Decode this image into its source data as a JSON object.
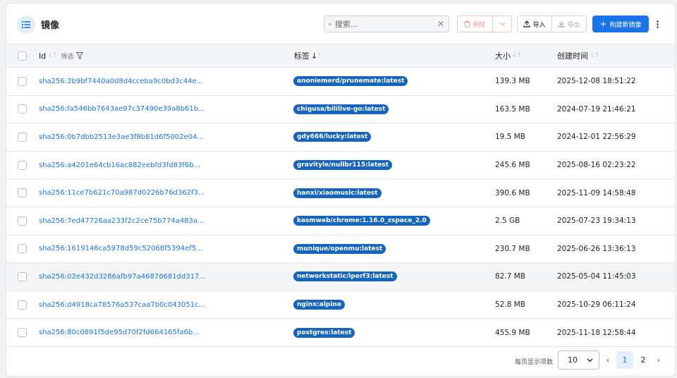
{
  "header": {
    "title": "镜像",
    "search_placeholder": "搜索...",
    "delete_label": "删除",
    "import_label": "导入",
    "export_label": "导出",
    "build_label": "构建新镜像"
  },
  "table": {
    "columns": {
      "id": "Id",
      "filter": "筛选",
      "tags": "标签",
      "size": "大小",
      "created": "创建时间"
    },
    "rows": [
      {
        "id": "sha256:2b9bf7440a0d8d4cceba9c0bd3c44e...",
        "tag": "anoniemerd/prunemate:latest",
        "size": "139.3 MB",
        "created": "2025-12-08 18:51:22"
      },
      {
        "id": "sha256:fa546bb7643ae97c37490e39a8b61b...",
        "tag": "chigusa/bililive-go:latest",
        "size": "163.5 MB",
        "created": "2024-07-19 21:46:21"
      },
      {
        "id": "sha256:0b7dbb2513e3ae3f8b81d6f5002e04...",
        "tag": "gdy666/lucky:latest",
        "size": "19.5 MB",
        "created": "2024-12-01 22:56:29"
      },
      {
        "id": "sha256:a4201e64cb16ac882eebfd3fd83f6b...",
        "tag": "gravityle/nullbr115:latest",
        "size": "245.6 MB",
        "created": "2025-08-16 02:23:22"
      },
      {
        "id": "sha256:11ce7b621c70a987d0226b76d362f3...",
        "tag": "hanxi/xiaomusic:latest",
        "size": "390.6 MB",
        "created": "2025-11-09 14:58:48"
      },
      {
        "id": "sha256:7ed47726aa233f2c2ce75b774a483a...",
        "tag": "kasmweb/chrome:1.16.0_zspace_2.0",
        "size": "2.5 GB",
        "created": "2025-07-23 19:34:13"
      },
      {
        "id": "sha256:1619146ca5978d59c52068f5394ef5...",
        "tag": "munique/openmu:latest",
        "size": "230.7 MB",
        "created": "2025-06-26 13:36:13"
      },
      {
        "id": "sha256:02e432d3286afb97a46876681dd317...",
        "tag": "networkstatic/iperf3:latest",
        "size": "82.7 MB",
        "created": "2025-05-04 11:45:03"
      },
      {
        "id": "sha256:d4918ca78576a537caa7b0c043051c...",
        "tag": "nginx:alpine",
        "size": "52.8 MB",
        "created": "2025-10-29 06:11:24"
      },
      {
        "id": "sha256:80c0891f5de95d70f2fd664165fa6b...",
        "tag": "postgres:latest",
        "size": "455.9 MB",
        "created": "2025-11-18 12:58:44"
      }
    ]
  },
  "pagination": {
    "per_page_label": "每页显示项数",
    "per_page_value": "10",
    "prev": "‹",
    "pages": [
      "1",
      "2"
    ],
    "current_page": "1",
    "next": "›"
  },
  "colors": {
    "accent": "#1a73e8",
    "tag_bg": "#1565c0",
    "delete": "#f0a0a0"
  }
}
